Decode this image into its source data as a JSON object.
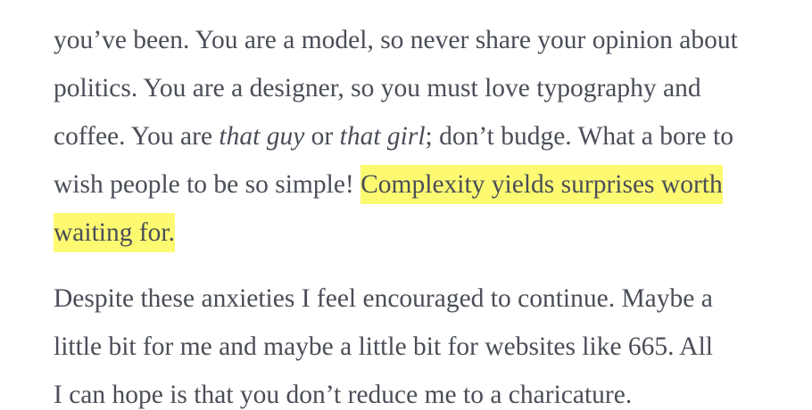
{
  "article": {
    "paragraph_1": {
      "line_1": "you’ve been. You are a model, so never share your opinion about",
      "line_2": "politics. You are a designer, so you must love typography and",
      "line_3_a": "coffee. You are ",
      "line_3_em_1": "that guy",
      "line_3_b": " or ",
      "line_3_em_2": "that girl",
      "line_3_c": "; don’t budge. What a bore to",
      "line_4_a": "wish people to be so simple! ",
      "highlight_1": "Complexity yields surprises worth",
      "highlight_2": "waiting for."
    },
    "paragraph_2": {
      "line_1": "Despite these anxieties I feel encouraged to continue. Maybe a",
      "line_2": "little bit for me and maybe a little bit for websites like 665. All",
      "line_3": "I can hope is that you don’t reduce me to a charicature."
    }
  },
  "colors": {
    "text": "#4a4e57",
    "highlight": "#fdfa72",
    "background": "#ffffff"
  }
}
